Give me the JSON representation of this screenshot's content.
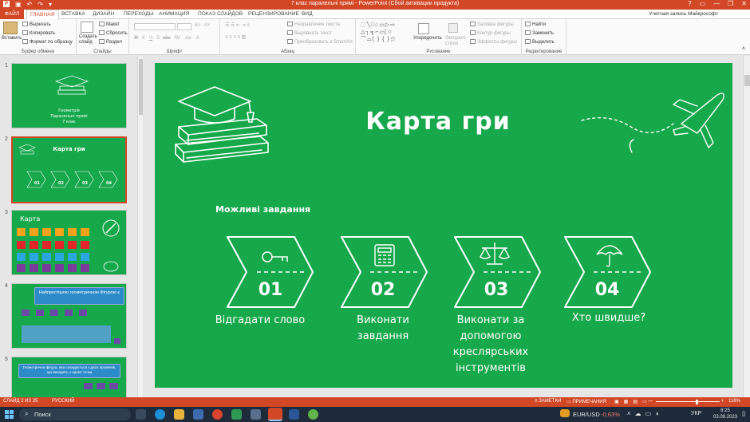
{
  "window": {
    "title": "7 клас паралельні прямі  -  PowerPoint (Сбой активации продукта)",
    "help": "?",
    "minimize": "—",
    "restore": "❐",
    "close": "✕"
  },
  "ribbon_tabs": {
    "file": "ФАЙЛ",
    "items": [
      "ГЛАВНАЯ",
      "ВСТАВКА",
      "ДИЗАЙН",
      "ПЕРЕХОДЫ",
      "АНИМАЦИЯ",
      "ПОКАЗ СЛАЙДОВ",
      "РЕЦЕНЗИРОВАНИЕ",
      "ВИД"
    ],
    "active": "ГЛАВНАЯ",
    "account": "Учетная запись Майкрософт"
  },
  "ribbon": {
    "clipboard": {
      "label": "Буфер обмена",
      "paste": "Вставить",
      "cut": "Вырезать",
      "copy": "Копировать",
      "format_painter": "Формат по образцу"
    },
    "slides": {
      "label": "Слайды",
      "new_slide": "Создать слайд",
      "layout": "Макет",
      "reset": "Сбросить",
      "section": "Раздел"
    },
    "font": {
      "label": "Шрифт",
      "bold": "Ж",
      "italic": "К",
      "underline": "Ч",
      "shadow": "S",
      "strike": "abc",
      "spacing": "AV",
      "case": "Aa",
      "color": "A"
    },
    "paragraph": {
      "label": "Абзац",
      "text_direction": "Направление текста",
      "align_text": "Выровнять текст",
      "smartart": "Преобразовать в SmartArt"
    },
    "drawing": {
      "label": "Рисование",
      "arrange": "Упорядочить",
      "quick_styles": "Экспресс-стили",
      "fill": "Заливка фигуры",
      "outline": "Контур фигуры",
      "effects": "Эффекты фигуры"
    },
    "editing": {
      "label": "Редактирование",
      "find": "Найти",
      "replace": "Заменить",
      "select": "Выделить"
    }
  },
  "thumbnails": [
    {
      "num": "1",
      "lines": [
        "Геометрія",
        "Паралельні прямі",
        "7 клас"
      ]
    },
    {
      "num": "2",
      "title": "Карта гри",
      "items": [
        "01",
        "02",
        "03",
        "04"
      ]
    },
    {
      "num": "3",
      "title": "Карта"
    },
    {
      "num": "4",
      "title": "Найпростішою геометричною Фігурою є"
    },
    {
      "num": "5",
      "title": "Геометрична фігура, яка складається з двох променів, що виходять з однієї точки"
    }
  ],
  "slide": {
    "title": "Карта гри",
    "subtitle": "Можливі завдання",
    "tasks": [
      {
        "num": "01",
        "label": "Відгадати слово",
        "icon": "key-icon"
      },
      {
        "num": "02",
        "label": "Виконати завдання",
        "icon": "calculator-icon"
      },
      {
        "num": "03",
        "label": "Виконати за допомогою креслярських інструментів",
        "icon": "scales-icon"
      },
      {
        "num": "04",
        "label": "Хто швидше?",
        "icon": "umbrella-icon"
      }
    ]
  },
  "status": {
    "slide_info": "СЛАЙД 2 ИЗ 25",
    "language": "РУССКИЙ",
    "notes": "ЗАМЕТКИ",
    "comments": "ПРИМЕЧАНИЯ",
    "zoom": "116%"
  },
  "taskbar": {
    "search": "Поиск",
    "currency": "EUR/USD",
    "change": "-0,63%",
    "lang": "УКР",
    "time": "8:25",
    "date": "03.09.2023"
  },
  "colors": {
    "slide_green": "#17a84b",
    "accent": "#d24726"
  }
}
